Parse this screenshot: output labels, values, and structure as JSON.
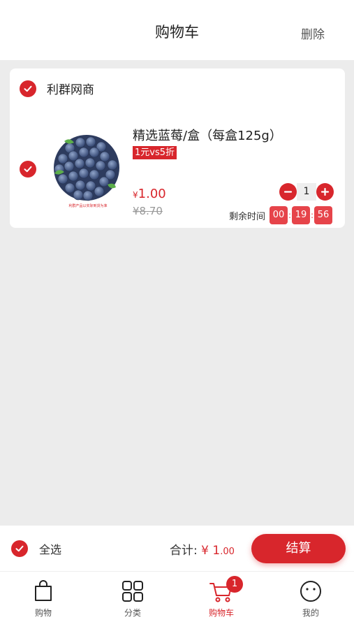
{
  "header": {
    "title": "购物车",
    "action": "删除"
  },
  "store": {
    "name": "利群网商"
  },
  "item": {
    "title": "精选蓝莓/盒（每盒125g）",
    "promo": "1元vs5折",
    "price_symbol": "¥",
    "price": "1.00",
    "original_price": "¥8.70",
    "quantity": "1",
    "timer_label": "剩余时间",
    "timer": {
      "hours": "00",
      "minutes": "19",
      "seconds": "56"
    },
    "thumb_caption": "利群产品以实际到货为准"
  },
  "checkout": {
    "select_all": "全选",
    "total_label": "合计:",
    "total_symbol": "¥",
    "total_int": "1",
    "total_cents": ".00",
    "button": "结算"
  },
  "tabbar": {
    "items": [
      {
        "label": "购物",
        "icon": "bag-icon"
      },
      {
        "label": "分类",
        "icon": "grid-icon"
      },
      {
        "label": "购物车",
        "icon": "cart-icon",
        "badge": "1",
        "active": true
      },
      {
        "label": "我的",
        "icon": "smile-icon"
      }
    ]
  },
  "colors": {
    "accent": "#d8262c",
    "timer": "#e6444a",
    "background": "#ececec"
  }
}
